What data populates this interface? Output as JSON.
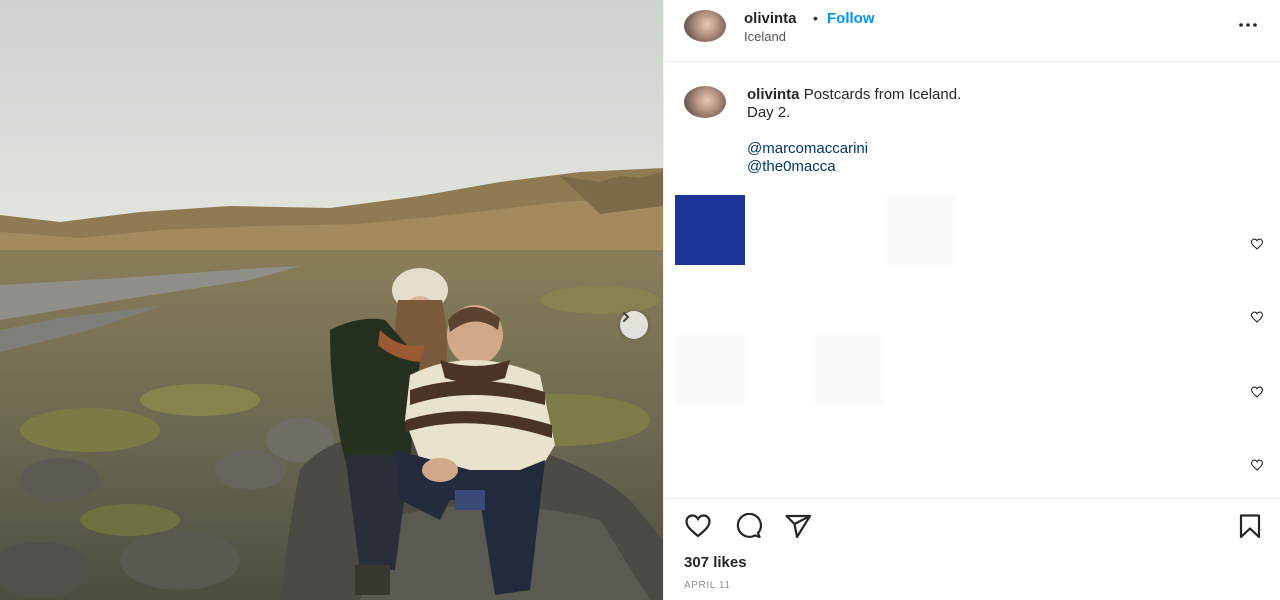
{
  "post": {
    "username": "olivinta",
    "separator": "•",
    "follow_label": "Follow",
    "location": "Iceland",
    "more_icon": "more-horizontal-icon"
  },
  "caption": {
    "username": "olivinta",
    "text_line1": "Postcards from Iceland.",
    "text_line2": "Day 2.",
    "mentions": [
      "@marcomaccarini",
      "@the0macca"
    ]
  },
  "footer": {
    "likes": "307 likes",
    "date": "APRIL 11"
  },
  "colors": {
    "accent": "#0095f6",
    "mention": "#00376b",
    "blue_block": "#1a3596"
  },
  "icons": {
    "like": "heart-icon",
    "comment": "comment-icon",
    "share": "share-icon",
    "save": "bookmark-icon",
    "next": "chevron-right-icon"
  }
}
